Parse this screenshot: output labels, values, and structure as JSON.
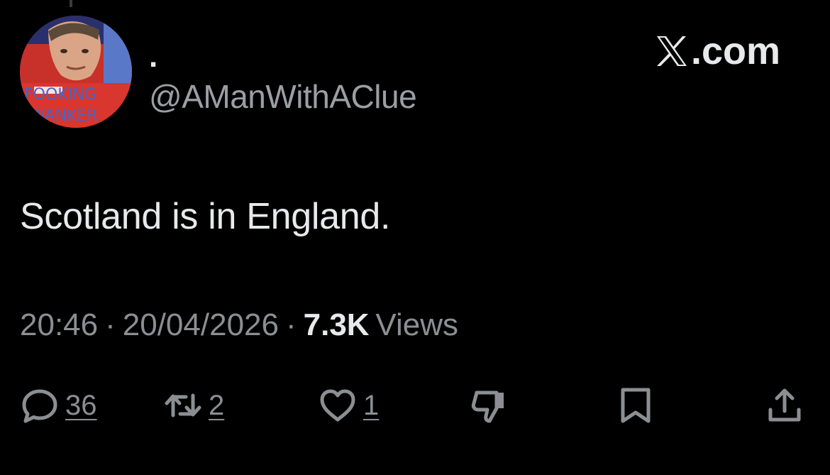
{
  "brand": {
    "name": ".com",
    "icon": "x-logo-icon"
  },
  "author": {
    "display_name": ".",
    "handle": "@AManWithAClue",
    "avatar_caption_line1": "FOOKING",
    "avatar_caption_line2": "WANKER"
  },
  "tweet": {
    "text": "Scotland is in England.",
    "time": "20:46",
    "date": "20/04/2026",
    "separator": "·",
    "views_count": "7.3K",
    "views_label": "Views"
  },
  "actions": {
    "reply": {
      "icon": "reply-icon",
      "count": "36"
    },
    "retweet": {
      "icon": "retweet-icon",
      "count": "2"
    },
    "like": {
      "icon": "heart-icon",
      "count": "1"
    },
    "dislike": {
      "icon": "thumbs-down-icon"
    },
    "bookmark": {
      "icon": "bookmark-icon"
    },
    "share": {
      "icon": "share-icon"
    }
  },
  "colors": {
    "background": "#000000",
    "primary_text": "#e7e9ea",
    "secondary_text": "#8b8f93"
  }
}
